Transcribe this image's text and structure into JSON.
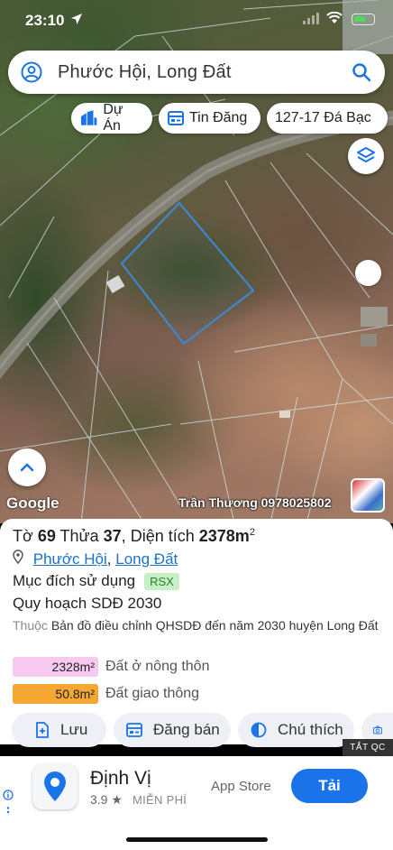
{
  "status_bar": {
    "time": "23:10"
  },
  "search": {
    "query": "Phước Hội, Long Đất"
  },
  "chips": [
    {
      "label": "Dự Án",
      "icon": "city-icon"
    },
    {
      "label": "Tin Đăng",
      "icon": "listing-card-icon"
    },
    {
      "label": "127-17 Đá Bạc",
      "icon": ""
    }
  ],
  "map": {
    "attribution": "Google",
    "owner_label": "Trần Thương 0978025802",
    "parcel_color": "#3b8ad9"
  },
  "parcel": {
    "to_label": "Tờ",
    "to_value": "69",
    "thua_label": "Thửa",
    "thua_value": "37",
    "area_label": "Diện tích",
    "area_value": "2378m",
    "area_unit_sup": "2",
    "address_ward": "Phước Hội",
    "address_sep": ", ",
    "address_district": "Long Đất",
    "purpose_label": "Mục đích sử dụng",
    "purpose_code": "RSX",
    "plan_title": "Quy hoạch SDĐ 2030",
    "plan_source_prefix": "Thuộc",
    "plan_source": "Bản đồ điều chỉnh QHSDĐ đến năm 2030 huyện Long Đất"
  },
  "land_use": [
    {
      "area": "2328m²",
      "label": "Đất ở nông thôn",
      "color": "#f7c8f0"
    },
    {
      "area": "50.8m²",
      "label": "Đất giao thông",
      "color": "#f5a733"
    }
  ],
  "actions": [
    {
      "label": "Lưu",
      "icon": "save-plus-icon"
    },
    {
      "label": "Đăng bán",
      "icon": "post-listing-icon"
    },
    {
      "label": "Chú thích",
      "icon": "legend-half-circle-icon"
    },
    {
      "label": "",
      "icon": "camera-icon"
    }
  ],
  "ad": {
    "badge": "TẮT QC",
    "app_name": "Định Vị",
    "rating": "3.9 ★",
    "price": "MIỄN PHÍ",
    "store": "App Store",
    "cta": "Tải"
  }
}
